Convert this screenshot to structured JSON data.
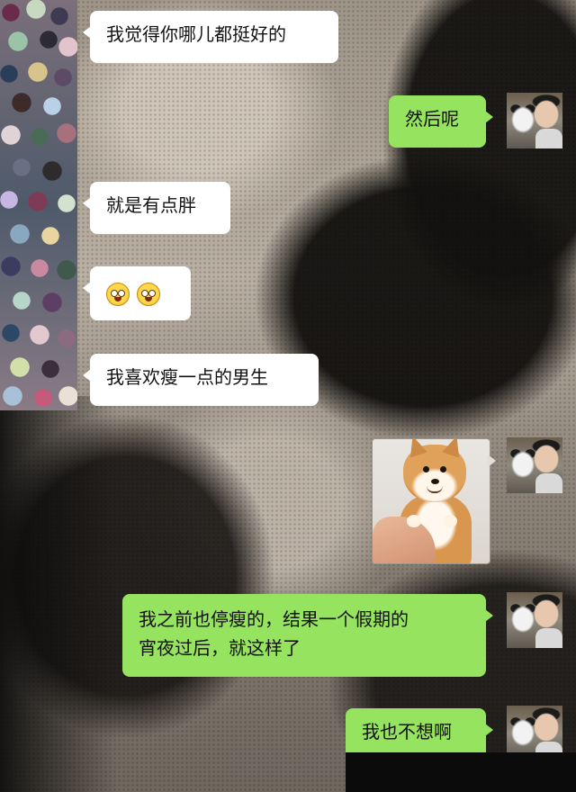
{
  "conversation": {
    "messages": [
      {
        "side": "in",
        "text": "我觉得你哪儿都挺好的"
      },
      {
        "side": "out",
        "text": "然后呢"
      },
      {
        "side": "in",
        "text": "就是有点胖"
      },
      {
        "side": "in",
        "emoji": [
          "sweat-smile-emoji-icon",
          "sweat-smile-emoji-icon"
        ]
      },
      {
        "side": "in",
        "text": "我喜欢瘦一点的男生"
      },
      {
        "side": "out",
        "image": "shiba-dog-photo"
      },
      {
        "side": "out",
        "text_lines": [
          "我之前也停瘦的，结果一个假期的",
          "宵夜过后，就这样了"
        ]
      },
      {
        "side": "out",
        "text": "我也不想啊"
      }
    ]
  },
  "msgs": {
    "m1": "我觉得你哪儿都挺好的",
    "m2": "然后呢",
    "m3": "就是有点胖",
    "m5": "我喜欢瘦一点的男生",
    "m7_line1": "我之前也停瘦的，结果一个假期的",
    "m7_line2": "宵夜过后，就这样了",
    "m8": "我也不想啊"
  },
  "colors": {
    "incoming_bubble": "#ffffff",
    "outgoing_bubble": "#95e35e"
  },
  "icons": {
    "other_avatar": "mosaic-blurred-avatar",
    "own_avatar": "husky-and-man-avatar"
  }
}
